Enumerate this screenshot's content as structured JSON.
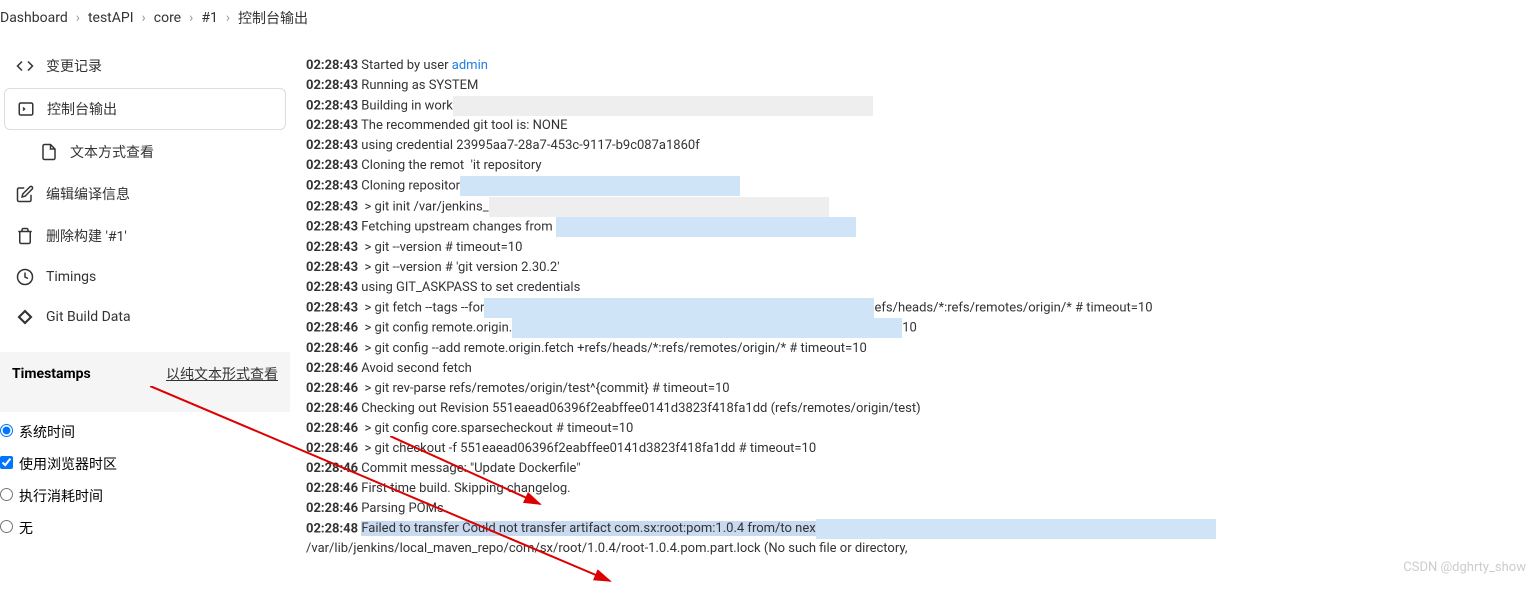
{
  "breadcrumb": [
    "Dashboard",
    "testAPI",
    "core",
    "#1",
    "控制台输出"
  ],
  "sidebar": {
    "changes": "变更记录",
    "console": "控制台输出",
    "text_view": "文本方式查看",
    "edit_build": "编辑编译信息",
    "delete_build": "删除构建 '#1'",
    "timings": "Timings",
    "git_build": "Git Build Data"
  },
  "timestamps": {
    "title": "Timestamps",
    "link": "以纯文本形式查看",
    "system_time": "系统时间",
    "browser_tz": "使用浏览器时区",
    "exec_time": "执行消耗时间",
    "none": "无"
  },
  "console": {
    "lines": [
      {
        "ts": "02:28:43",
        "text": " Started by user ",
        "link": "admin"
      },
      {
        "ts": "02:28:43",
        "text": " Running as SYSTEM"
      },
      {
        "ts": "02:28:43",
        "text": " Building in work",
        "blur_width": 420
      },
      {
        "ts": "02:28:43",
        "text": " The recommended git tool is: NONE"
      },
      {
        "ts": "02:28:43",
        "text": " using credential 23995aa7-28a7-453c-9117-b9c087a1860f"
      },
      {
        "ts": "02:28:43",
        "text": " Cloning the remot  'it repository",
        "blur_mid": true
      },
      {
        "ts": "02:28:43",
        "text": " Cloning repositor",
        "blur_blue_width": 280
      },
      {
        "ts": "02:28:43",
        "text": "  > git init /var/jenkins_",
        "blur_width": 340
      },
      {
        "ts": "02:28:43",
        "text": " Fetching upstream changes from ",
        "blur_blue_width": 300
      },
      {
        "ts": "02:28:43",
        "text": "  > git --version # timeout=10"
      },
      {
        "ts": "02:28:43",
        "text": "  > git --version # 'git version 2.30.2'"
      },
      {
        "ts": "02:28:43",
        "text": " using GIT_ASKPASS to set credentials"
      },
      {
        "ts": "02:28:43",
        "text": "  > git fetch --tags --for",
        "blur_blue_width": 390,
        "suffix": "efs/heads/*:refs/remotes/origin/* # timeout=10"
      },
      {
        "ts": "02:28:46",
        "text": "  > git config remote.origin.",
        "blur_blue_width": 390,
        "suffix": "10"
      },
      {
        "ts": "02:28:46",
        "text": "  > git config --add remote.origin.fetch +refs/heads/*:refs/remotes/origin/* # timeout=10"
      },
      {
        "ts": "02:28:46",
        "text": " Avoid second fetch"
      },
      {
        "ts": "02:28:46",
        "text": "  > git rev-parse refs/remotes/origin/test^{commit} # timeout=10"
      },
      {
        "ts": "02:28:46",
        "text": " Checking out Revision 551eaead06396f2eabffee0141d3823f418fa1dd (refs/remotes/origin/test)"
      },
      {
        "ts": "02:28:46",
        "text": "  > git config core.sparsecheckout # timeout=10"
      },
      {
        "ts": "02:28:46",
        "text": "  > git checkout -f 551eaead06396f2eabffee0141d3823f418fa1dd # timeout=10"
      },
      {
        "ts": "02:28:46",
        "text": " Commit message: \"Update Dockerfile\""
      },
      {
        "ts": "02:28:46",
        "text": " First time build. Skipping changelog."
      },
      {
        "ts": "02:28:46",
        "text": " Parsing POMs"
      },
      {
        "ts": "02:28:48",
        "text": " ",
        "error": "Failed to transfer Could not transfer artifact com.sx:root:pom:1.0.4 from/to nex",
        "blur_blue_width": 400
      },
      {
        "continuation": "/var/lib/jenkins/local_maven_repo/com/sx/root/1.0.4/root-1.0.4.pom.part.lock (No such file or directory,"
      }
    ]
  },
  "watermark": "CSDN @dghrty_show"
}
